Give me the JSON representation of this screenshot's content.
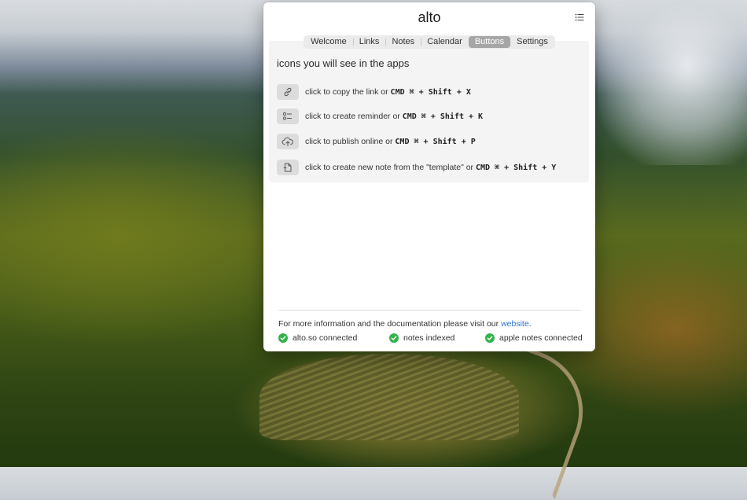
{
  "window": {
    "title": "alto"
  },
  "tabs": [
    {
      "label": "Welcome",
      "active": false
    },
    {
      "label": "Links",
      "active": false
    },
    {
      "label": "Notes",
      "active": false
    },
    {
      "label": "Calendar",
      "active": false
    },
    {
      "label": "Buttons",
      "active": true
    },
    {
      "label": "Settings",
      "active": false
    }
  ],
  "section": {
    "title": "icons you will see in the apps"
  },
  "buttons": [
    {
      "icon": "link-icon",
      "text": "click to copy the link or ",
      "shortcut": "CMD ⌘ + Shift + X"
    },
    {
      "icon": "reminder-list-icon",
      "text": "click to create reminder or ",
      "shortcut": "CMD ⌘ + Shift + K"
    },
    {
      "icon": "cloud-upload-icon",
      "text": "click to publish online or ",
      "shortcut": "CMD ⌘ + Shift + P"
    },
    {
      "icon": "template-note-icon",
      "text": "click to create new note from the \"template\" or ",
      "shortcut": "CMD ⌘ + Shift + Y"
    }
  ],
  "footer": {
    "info_text": "For more information and the documentation please visit our ",
    "link_text": "website",
    "info_suffix": ".",
    "statuses": [
      {
        "label": "alto.so connected",
        "icon": "check-circle-icon"
      },
      {
        "label": "notes indexed",
        "icon": "check-circle-icon"
      },
      {
        "label": "apple notes connected",
        "icon": "check-circle-icon"
      }
    ]
  },
  "colors": {
    "accent_link": "#2673d9",
    "status_ok": "#34b24a",
    "active_tab": "#a6a6a6"
  }
}
